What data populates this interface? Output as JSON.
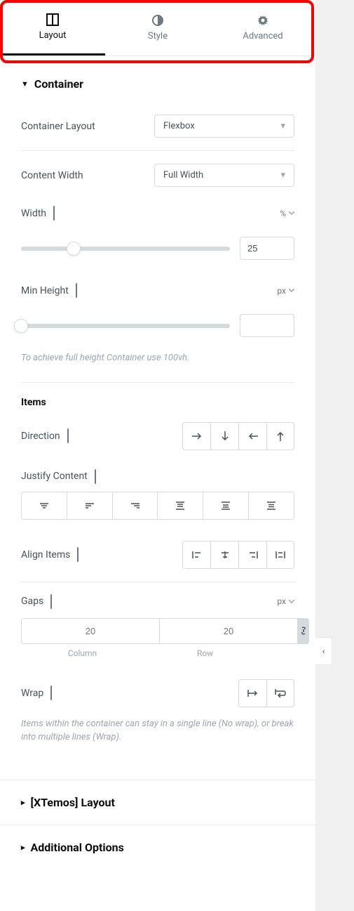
{
  "tabs": {
    "layout": "Layout",
    "style": "Style",
    "advanced": "Advanced"
  },
  "sections": {
    "container": {
      "title": "Container",
      "container_layout": {
        "label": "Container Layout",
        "value": "Flexbox"
      },
      "content_width": {
        "label": "Content Width",
        "value": "Full Width"
      },
      "width": {
        "label": "Width",
        "unit": "%",
        "value": "25",
        "percent": 25
      },
      "min_height": {
        "label": "Min Height",
        "unit": "px",
        "value": ""
      },
      "min_height_hint": "To achieve full height Container use 100vh."
    },
    "items": {
      "title": "Items",
      "direction": {
        "label": "Direction"
      },
      "justify_content": {
        "label": "Justify Content"
      },
      "align_items": {
        "label": "Align Items"
      },
      "gaps": {
        "label": "Gaps",
        "unit": "px",
        "column": "20",
        "row": "20",
        "column_label": "Column",
        "row_label": "Row"
      },
      "wrap": {
        "label": "Wrap"
      },
      "wrap_hint": "Items within the container can stay in a single line (No wrap), or break into multiple lines (Wrap)."
    },
    "xtemos_layout": {
      "title": "[XTemos] Layout"
    },
    "additional_options": {
      "title": "Additional Options"
    }
  }
}
